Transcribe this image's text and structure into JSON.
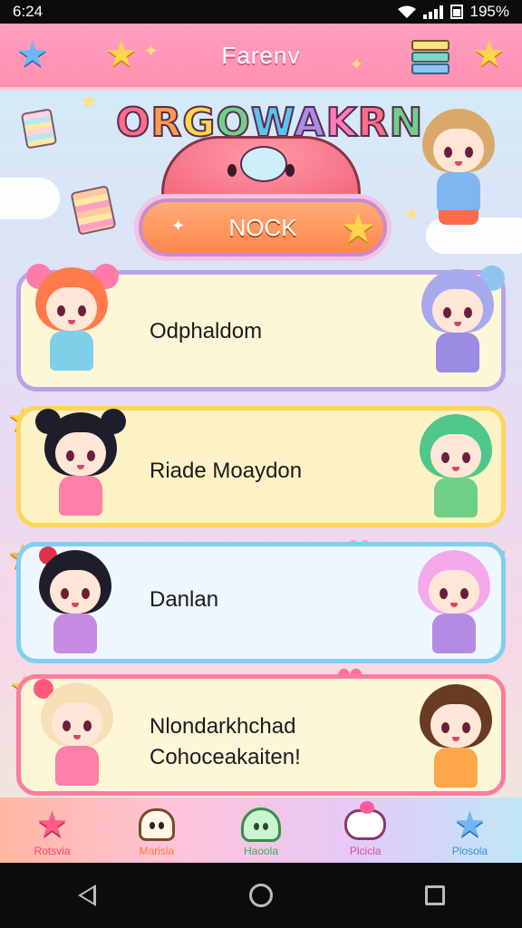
{
  "status": {
    "time": "6:24",
    "battery": "195%"
  },
  "header": {
    "title": "Farenv",
    "icons": [
      "star-icon",
      "star-icon",
      "sparkle-icon",
      "book-stack-icon",
      "star-icon"
    ]
  },
  "logo": {
    "text": "ORGOWAKRN",
    "letter_colors": [
      "#ff6b8a",
      "#ff9a4d",
      "#ffd54a",
      "#6fd08c",
      "#5cc3ef",
      "#a98bef",
      "#ff7bc0",
      "#ff6b8a",
      "#6fd08c"
    ]
  },
  "main_button": {
    "label": "NOCK",
    "icon": "star-icon"
  },
  "list": [
    {
      "label": "Odphaldom",
      "border": "#b9a2ea",
      "bg": "#fdf7d8",
      "left_char": "orange-hair-girl",
      "right_char": "blue-hair-girl"
    },
    {
      "label": "Riade Moaydon",
      "border": "#ffd45a",
      "bg": "#fdf2c6",
      "left_char": "black-pigtails-girl",
      "right_char": "green-hair-boy"
    },
    {
      "label": "Danlan",
      "border": "#7fd0ef",
      "bg": "#eef7ff",
      "left_char": "black-hair-girl",
      "right_char": "pink-hair-girl"
    },
    {
      "label": "Nlondarkhchad\nCohoceakaiten!",
      "border": "#ff7c9e",
      "bg": "#fdf7d8",
      "left_char": "blonde-hair-girl",
      "right_char": "brown-hair-boy"
    }
  ],
  "bottom_nav": [
    {
      "label": "Rotsvia",
      "icon": "star-icon",
      "color": "#ff3b6a"
    },
    {
      "label": "Marisla",
      "icon": "ghost-icon",
      "color": "#ff7a3a"
    },
    {
      "label": "Haoola",
      "icon": "slime-icon",
      "color": "#3fae5a"
    },
    {
      "label": "Plcicla",
      "icon": "cake-icon",
      "color": "#d94aa0"
    },
    {
      "label": "Plosola",
      "icon": "star-icon",
      "color": "#3a8fd9"
    }
  ]
}
